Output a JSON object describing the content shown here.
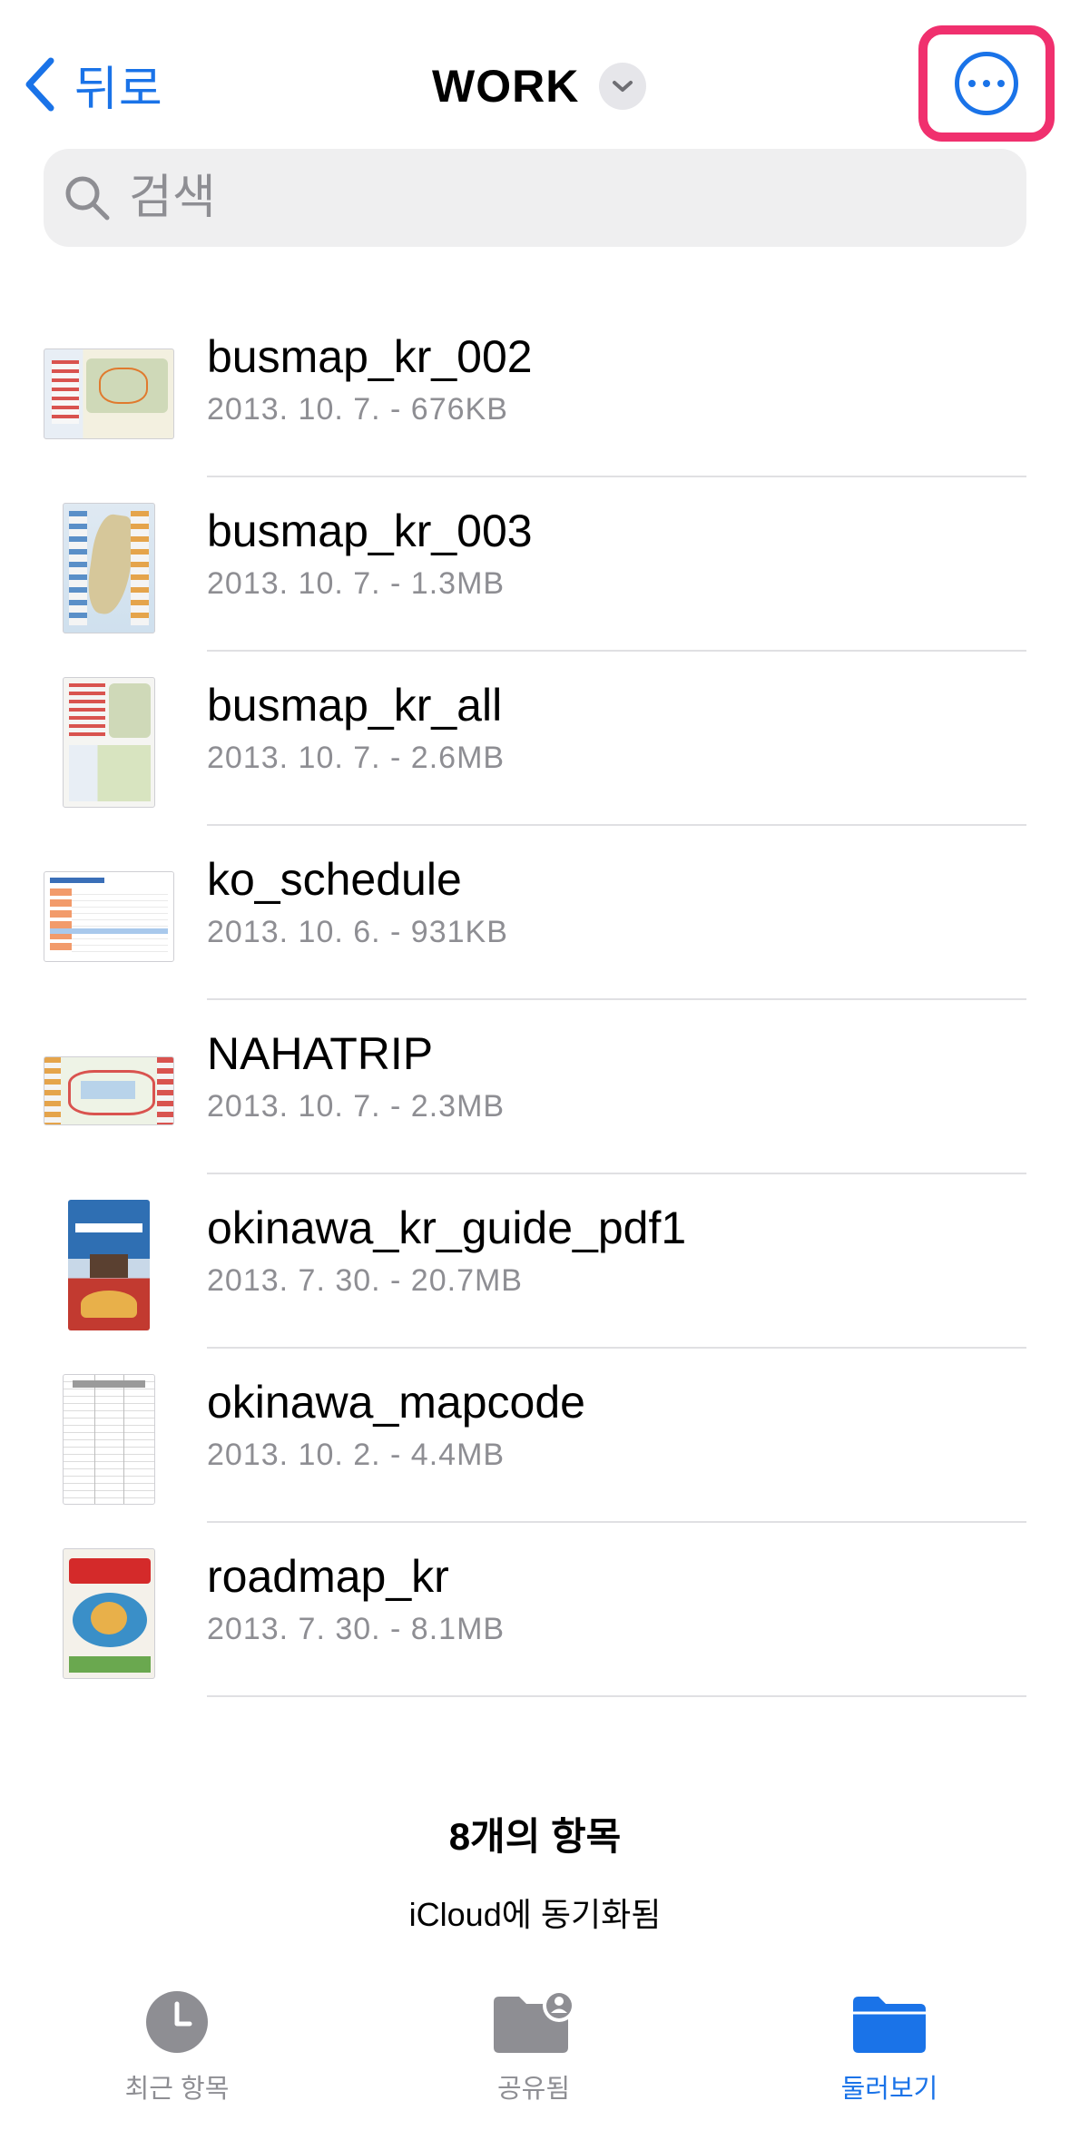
{
  "nav": {
    "back_label": "뒤로",
    "title": "WORK"
  },
  "search": {
    "placeholder": "검색"
  },
  "files": [
    {
      "name": "busmap_kr_002",
      "meta": "2013. 10. 7. - 676KB"
    },
    {
      "name": "busmap_kr_003",
      "meta": "2013. 10. 7. - 1.3MB"
    },
    {
      "name": "busmap_kr_all",
      "meta": "2013. 10. 7. - 2.6MB"
    },
    {
      "name": "ko_schedule",
      "meta": "2013. 10. 6. - 931KB"
    },
    {
      "name": "NAHATRIP",
      "meta": "2013. 10. 7. - 2.3MB"
    },
    {
      "name": "okinawa_kr_guide_pdf1",
      "meta": "2013. 7. 30. - 20.7MB"
    },
    {
      "name": "okinawa_mapcode",
      "meta": "2013. 10. 2. - 4.4MB"
    },
    {
      "name": "roadmap_kr",
      "meta": "2013. 7. 30. - 8.1MB"
    }
  ],
  "summary": {
    "count": "8개의 항목",
    "sync": "iCloud에 동기화됨"
  },
  "tabs": [
    {
      "label": "최근 항목",
      "icon": "clock-icon"
    },
    {
      "label": "공유됨",
      "icon": "shared-folder-icon"
    },
    {
      "label": "둘러보기",
      "icon": "folder-icon",
      "active": true
    }
  ],
  "colors": {
    "accent": "#1a73e8",
    "highlight": "#f0306e",
    "secondary_text": "#8e8e93"
  }
}
